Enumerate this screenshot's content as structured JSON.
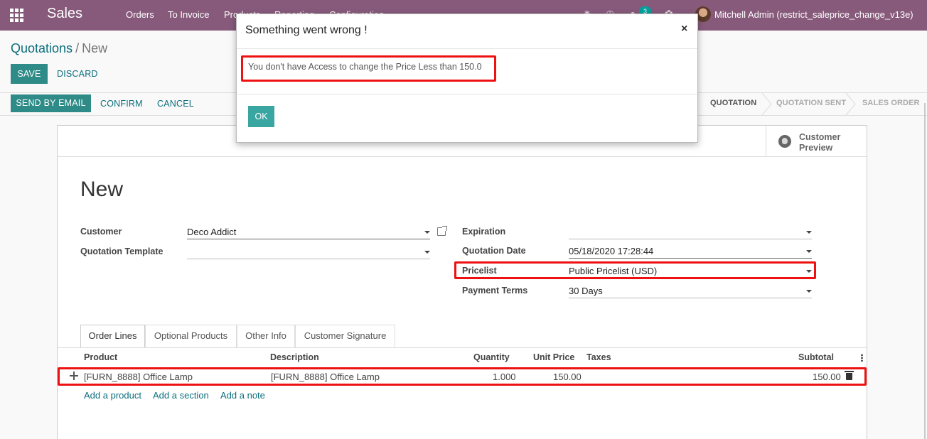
{
  "navbar": {
    "app_name": "Sales",
    "menu": [
      "Orders",
      "To Invoice",
      "Products",
      "Reporting",
      "Configuration"
    ],
    "chat_count": "3",
    "user_name": "Mitchell Admin (restrict_saleprice_change_v13e)"
  },
  "breadcrumb": {
    "parent": "Quotations",
    "current": "New"
  },
  "buttons": {
    "save": "SAVE",
    "discard": "DISCARD",
    "send_by_email": "SEND BY EMAIL",
    "confirm": "CONFIRM",
    "cancel": "CANCEL"
  },
  "statusbar": {
    "steps": [
      "QUOTATION",
      "QUOTATION SENT",
      "SALES ORDER"
    ],
    "active": "QUOTATION"
  },
  "smart_button": {
    "label": "Customer Preview"
  },
  "form": {
    "title": "New",
    "left": [
      {
        "label": "Customer",
        "value": "Deco Addict"
      },
      {
        "label": "Quotation Template",
        "value": ""
      }
    ],
    "right": [
      {
        "label": "Expiration",
        "value": ""
      },
      {
        "label": "Quotation Date",
        "value": "05/18/2020 17:28:44"
      },
      {
        "label": "Pricelist",
        "value": "Public Pricelist (USD)"
      },
      {
        "label": "Payment Terms",
        "value": "30 Days"
      }
    ]
  },
  "tabs": [
    "Order Lines",
    "Optional Products",
    "Other Info",
    "Customer Signature"
  ],
  "order_lines": {
    "headers": [
      "Product",
      "Description",
      "Quantity",
      "Unit Price",
      "Taxes",
      "Subtotal"
    ],
    "rows": [
      {
        "product": "[FURN_8888] Office Lamp",
        "description": "[FURN_8888] Office Lamp",
        "quantity": "1.000",
        "unit_price": "150.00",
        "taxes": "",
        "subtotal": "150.00"
      }
    ],
    "links": [
      "Add a product",
      "Add a section",
      "Add a note"
    ]
  },
  "dialog": {
    "title": "Something went wrong !",
    "close": "×",
    "message": "You don't have Access to change the Price Less than 150.0",
    "ok": "OK"
  },
  "colors": {
    "navbar": "#875a7b",
    "primary": "#00a09d",
    "highlight": "#ee1111"
  }
}
